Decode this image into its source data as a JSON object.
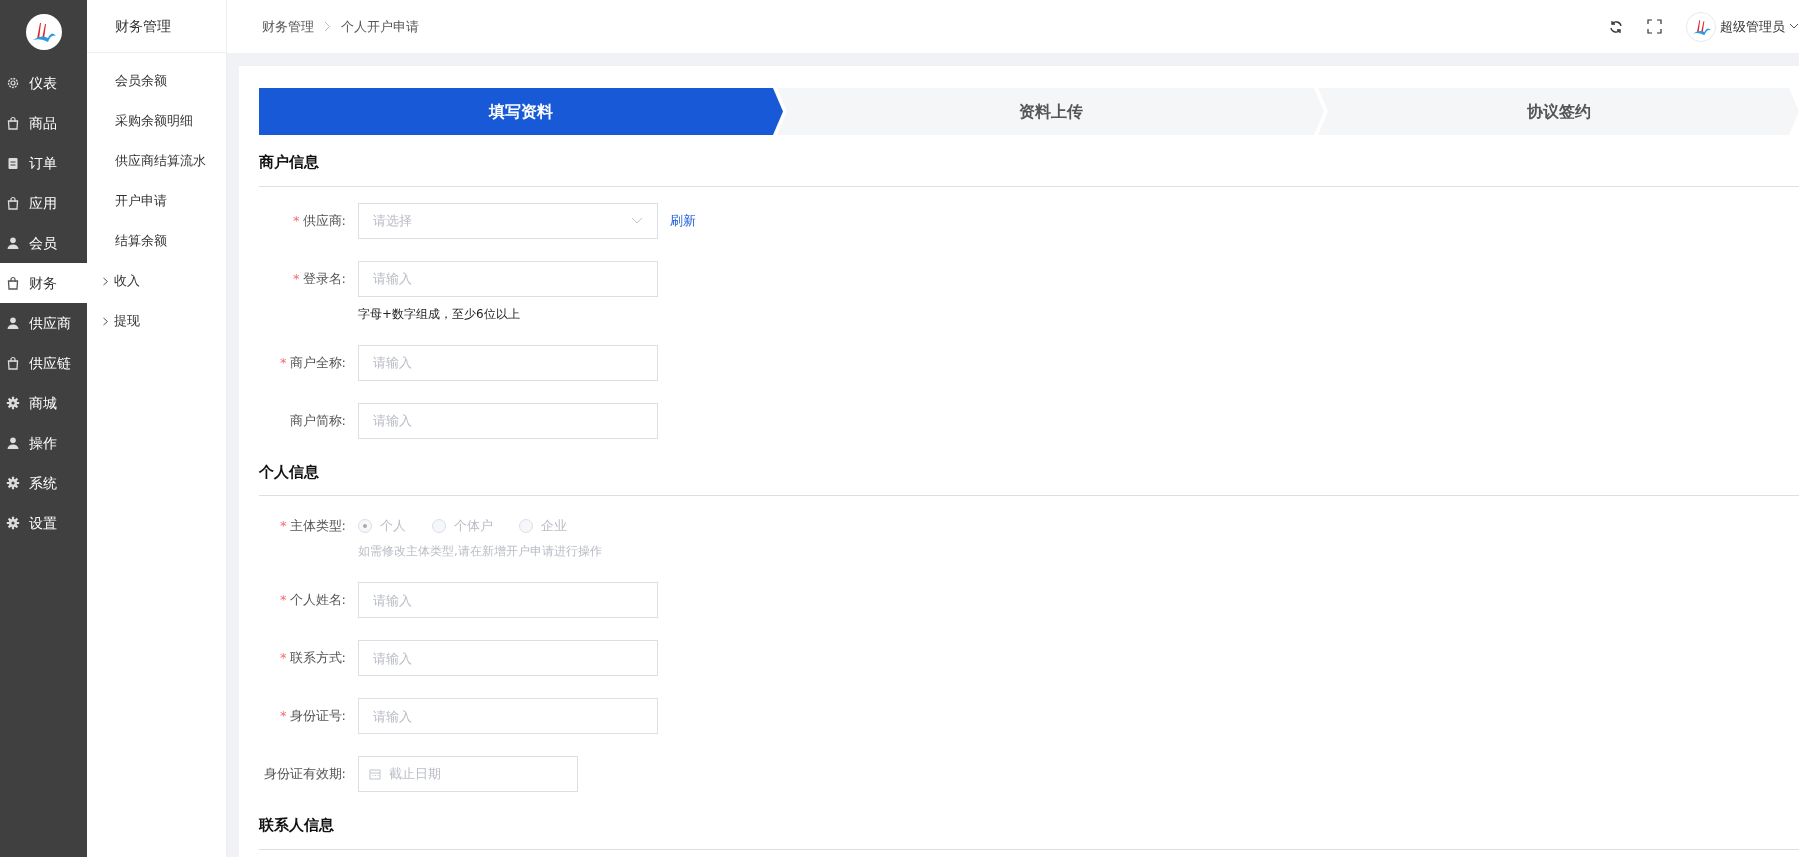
{
  "nav": {
    "items": [
      {
        "label": "仪表",
        "kind": "gauge",
        "selected": false
      },
      {
        "label": "商品",
        "kind": "bag",
        "selected": false
      },
      {
        "label": "订单",
        "kind": "clipboard",
        "selected": false
      },
      {
        "label": "应用",
        "kind": "bag",
        "selected": false
      },
      {
        "label": "会员",
        "kind": "person",
        "selected": false
      },
      {
        "label": "财务",
        "kind": "bag",
        "selected": true
      },
      {
        "label": "供应商",
        "kind": "person",
        "selected": false
      },
      {
        "label": "供应链",
        "kind": "bag",
        "selected": false
      },
      {
        "label": "商城",
        "kind": "cog",
        "selected": false
      },
      {
        "label": "操作",
        "kind": "person",
        "selected": false
      },
      {
        "label": "系统",
        "kind": "cog",
        "selected": false
      },
      {
        "label": "设置",
        "kind": "cog",
        "selected": false
      }
    ]
  },
  "submenu": {
    "title": "财务管理",
    "items": [
      {
        "label": "会员余额",
        "kind": "link"
      },
      {
        "label": "采购余额明细",
        "kind": "link"
      },
      {
        "label": "供应商结算流水",
        "kind": "link"
      },
      {
        "label": "开户申请",
        "kind": "link"
      },
      {
        "label": "结算余额",
        "kind": "link"
      },
      {
        "label": "收入",
        "kind": "group",
        "expanded": false
      },
      {
        "label": "提现",
        "kind": "group",
        "expanded": false
      }
    ]
  },
  "header": {
    "breadcrumbs": [
      "财务管理",
      "个人开户申请"
    ],
    "user": "超级管理员"
  },
  "steps": [
    {
      "label": "填写资料",
      "selected": true
    },
    {
      "label": "资料上传",
      "selected": false
    },
    {
      "label": "协议签约",
      "selected": false
    }
  ],
  "sections": [
    {
      "title": "商户信息",
      "fields": [
        {
          "kind": "select",
          "label": "供应商:",
          "required_mark": "*",
          "placeholder": "请选择",
          "action": "刷新"
        },
        {
          "kind": "text",
          "label": "登录名:",
          "required_mark": "*",
          "placeholder": "请输入",
          "hint": "字母+数字组成，至少6位以上",
          "hint_muted": false
        },
        {
          "kind": "text",
          "label": "商户全称:",
          "required_mark": "*",
          "placeholder": "请输入"
        },
        {
          "kind": "text",
          "label": "商户简称:",
          "placeholder": "请输入"
        }
      ]
    },
    {
      "title": "个人信息",
      "fields": [
        {
          "kind": "radio",
          "label": "主体类型:",
          "required_mark": "*",
          "disabled": true,
          "options": [
            {
              "label": "个人",
              "selected": true
            },
            {
              "label": "个体户",
              "selected": false
            },
            {
              "label": "企业",
              "selected": false
            }
          ],
          "hint": "如需修改主体类型,请在新增开户申请进行操作",
          "hint_muted": true
        },
        {
          "kind": "text",
          "label": "个人姓名:",
          "required_mark": "*",
          "placeholder": "请输入"
        },
        {
          "kind": "text",
          "label": "联系方式:",
          "required_mark": "*",
          "placeholder": "请输入"
        },
        {
          "kind": "text",
          "label": "身份证号:",
          "required_mark": "*",
          "placeholder": "请输入"
        },
        {
          "kind": "date",
          "label": "身份证有效期:",
          "placeholder": "截止日期"
        }
      ]
    },
    {
      "title": "联系人信息"
    }
  ]
}
